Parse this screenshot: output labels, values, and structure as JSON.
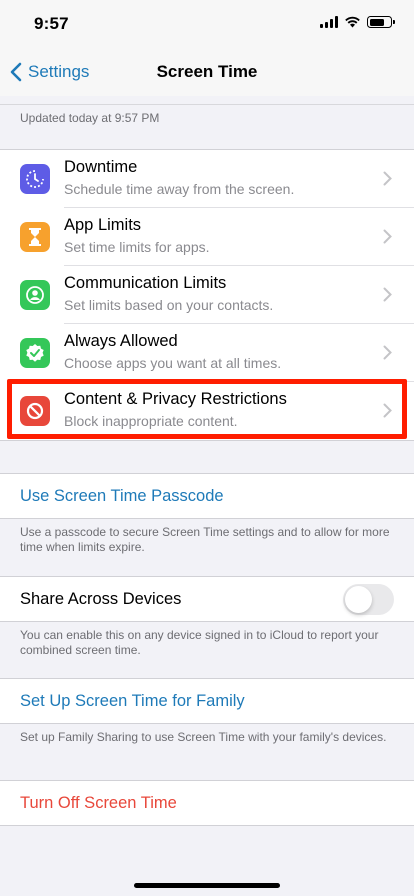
{
  "status_bar": {
    "time": "9:57"
  },
  "nav": {
    "back_label": "Settings",
    "title": "Screen Time"
  },
  "updated_text": "Updated today at 9:57 PM",
  "menu": [
    {
      "title": "Downtime",
      "subtitle": "Schedule time away from the screen.",
      "icon": "downtime-icon",
      "color": "#5e5ce6"
    },
    {
      "title": "App Limits",
      "subtitle": "Set time limits for apps.",
      "icon": "hourglass-icon",
      "color": "#f7a12d"
    },
    {
      "title": "Communication Limits",
      "subtitle": "Set limits based on your contacts.",
      "icon": "contact-icon",
      "color": "#34c759"
    },
    {
      "title": "Always Allowed",
      "subtitle": "Choose apps you want at all times.",
      "icon": "checkmark-badge-icon",
      "color": "#34c759"
    },
    {
      "title": "Content & Privacy Restrictions",
      "subtitle": "Block inappropriate content.",
      "icon": "restriction-icon",
      "color": "#e8473a"
    }
  ],
  "passcode": {
    "label": "Use Screen Time Passcode",
    "note": "Use a passcode to secure Screen Time settings and to allow for more time when limits expire."
  },
  "share": {
    "label": "Share Across Devices",
    "enabled": false,
    "note": "You can enable this on any device signed in to iCloud to report your combined screen time."
  },
  "family": {
    "label": "Set Up Screen Time for Family",
    "note": "Set up Family Sharing to use Screen Time with your family's devices."
  },
  "turn_off": {
    "label": "Turn Off Screen Time"
  },
  "colors": {
    "accent": "#1e7ab8",
    "destructive": "#e8473a",
    "highlight": "#ff1d00"
  }
}
